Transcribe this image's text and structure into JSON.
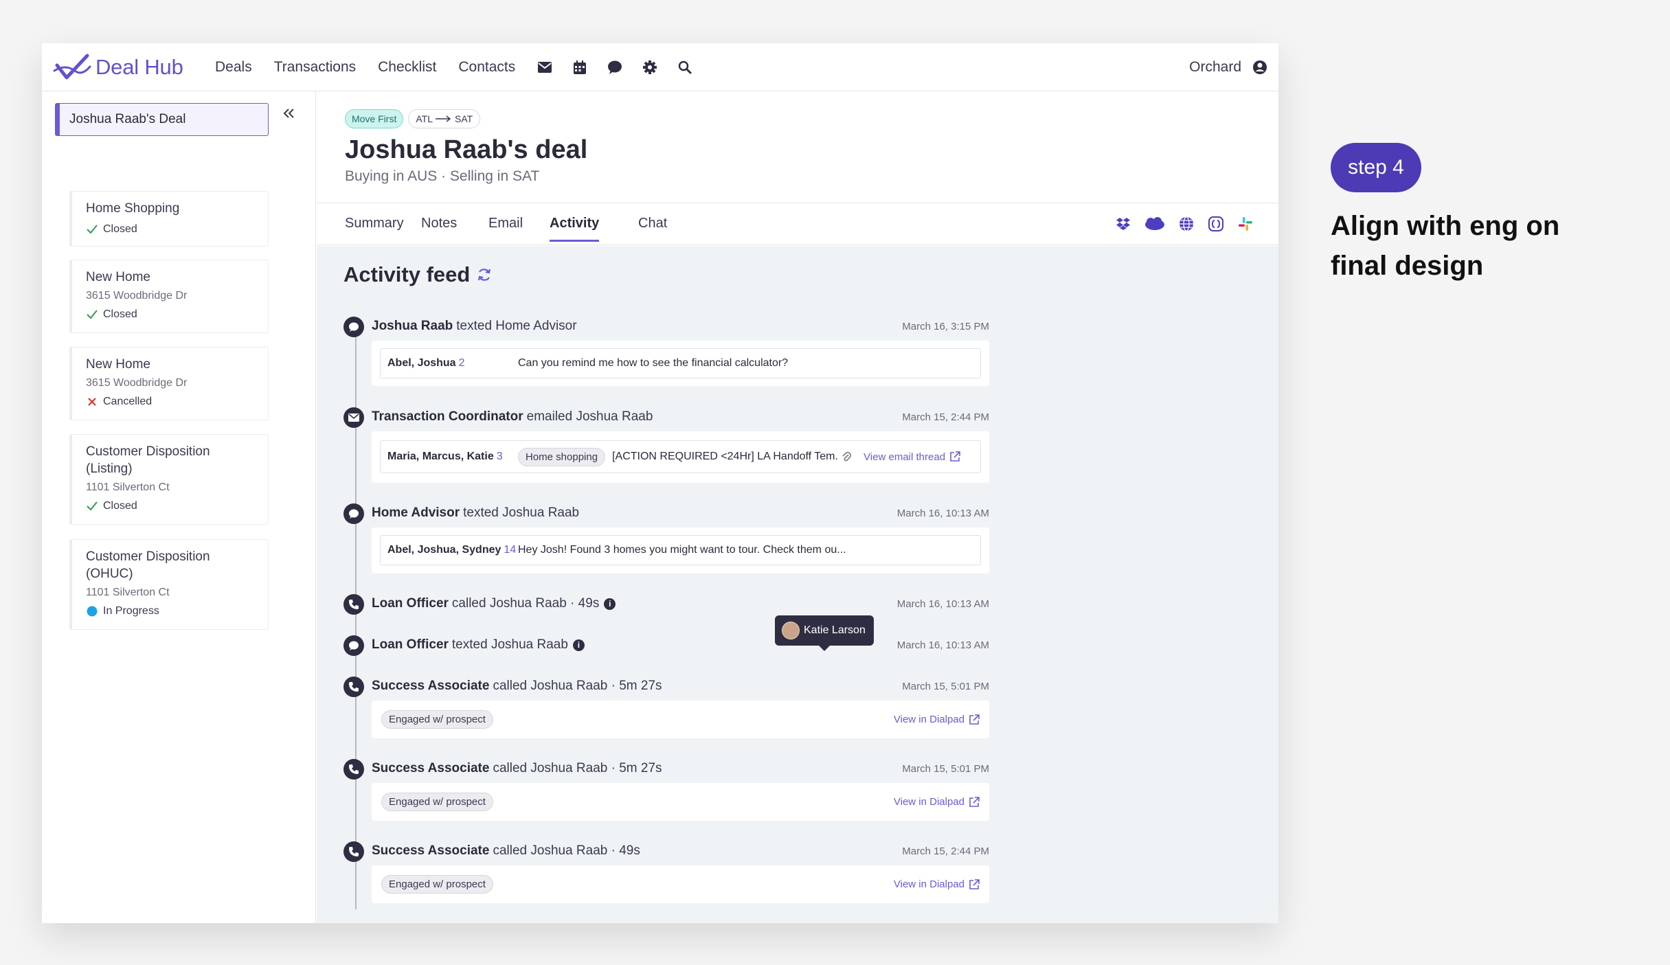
{
  "app": {
    "logo_text": "Deal Hub",
    "nav": [
      "Deals",
      "Transactions",
      "Checklist",
      "Contacts"
    ],
    "nav_icons": [
      "mail-icon",
      "calendar-icon",
      "chat-icon",
      "gear-icon",
      "search-icon"
    ],
    "org": "Orchard"
  },
  "sidebar": {
    "selected_deal": "Joshua Raab's Deal",
    "items": [
      {
        "title": "Home Shopping",
        "address": "",
        "status": "Closed",
        "status_icon": "check-icon"
      },
      {
        "title": "New Home",
        "address": "3615 Woodbridge Dr",
        "status": "Closed",
        "status_icon": "check-icon"
      },
      {
        "title": "New Home",
        "address": "3615 Woodbridge Dr",
        "status": "Cancelled",
        "status_icon": "x-icon"
      },
      {
        "title": "Customer Disposition (Listing)",
        "address": "1101 Silverton Ct",
        "status": "Closed",
        "status_icon": "check-icon"
      },
      {
        "title": "Customer Disposition (OHUC)",
        "address": "1101 Silverton Ct",
        "status": "In Progress",
        "status_icon": "progress-dot-icon"
      }
    ]
  },
  "deal": {
    "badge_move": "Move First",
    "route_from": "ATL",
    "route_to": "SAT",
    "title": "Joshua Raab's deal",
    "subtitle": "Buying in AUS · Selling in SAT"
  },
  "tabs": [
    "Summary",
    "Notes",
    "Email",
    "Activity",
    "Chat"
  ],
  "active_tab": "Activity",
  "integrations": [
    "dropbox-icon",
    "salesforce-icon",
    "globe-icon",
    "bracket-icon",
    "slack-icon"
  ],
  "feed": {
    "title": "Activity feed",
    "events": [
      {
        "actor": "Joshua Raab",
        "action": "texted Home Advisor",
        "date": "March 16, 3:15 PM",
        "icon": "chat-bubble-icon",
        "msg_who": "Abel, Joshua",
        "msg_count": "2",
        "msg_body": "Can you remind me how to see the financial calculator?"
      },
      {
        "actor": "Transaction Coordinator",
        "action": "emailed Joshua Raab",
        "date": "March 15, 2:44 PM",
        "icon": "envelope-icon",
        "msg_who": "Maria, Marcus, Katie",
        "msg_count": "3",
        "chip": "Home shopping",
        "msg_body": "[ACTION REQUIRED <24Hr] LA Handoff Tem...",
        "link": "View email thread"
      },
      {
        "actor": "Home Advisor",
        "action": "texted Joshua Raab",
        "date": "March 16, 10:13 AM",
        "icon": "chat-bubble-icon",
        "msg_who": "Abel, Joshua, Sydney",
        "msg_count": "14",
        "msg_body": "Hey Josh! Found 3 homes you might want to tour. Check them ou..."
      },
      {
        "actor": "Loan Officer",
        "action": "called Joshua Raab · 49s",
        "date": "March 16, 10:13 AM",
        "icon": "phone-icon"
      },
      {
        "actor": "Loan Officer",
        "action": "texted Joshua Raab",
        "date": "March 16, 10:13 AM",
        "icon": "chat-bubble-icon"
      },
      {
        "actor": "Success Associate",
        "action": "called Joshua Raab · 5m 27s",
        "date": "March 15, 5:01 PM",
        "icon": "phone-icon",
        "chip": "Engaged w/ prospect",
        "link": "View in Dialpad"
      },
      {
        "actor": "Success Associate",
        "action": "called Joshua Raab · 5m 27s",
        "date": "March 15, 5:01 PM",
        "icon": "phone-icon",
        "chip": "Engaged w/ prospect",
        "link": "View in Dialpad"
      },
      {
        "actor": "Success Associate",
        "action": "called Joshua Raab · 49s",
        "date": "March 15, 2:44 PM",
        "icon": "phone-icon",
        "chip": "Engaged w/ prospect",
        "link": "View in Dialpad"
      }
    ],
    "tooltip": "Katie Larson"
  },
  "annotation": {
    "step": "step 4",
    "text": "Align with eng on final design"
  },
  "colors": {
    "accent": "#6a5cd4",
    "dark": "#2f2d42",
    "feed_bg": "#f0f3f5",
    "step_bg": "#4c3bb4"
  }
}
